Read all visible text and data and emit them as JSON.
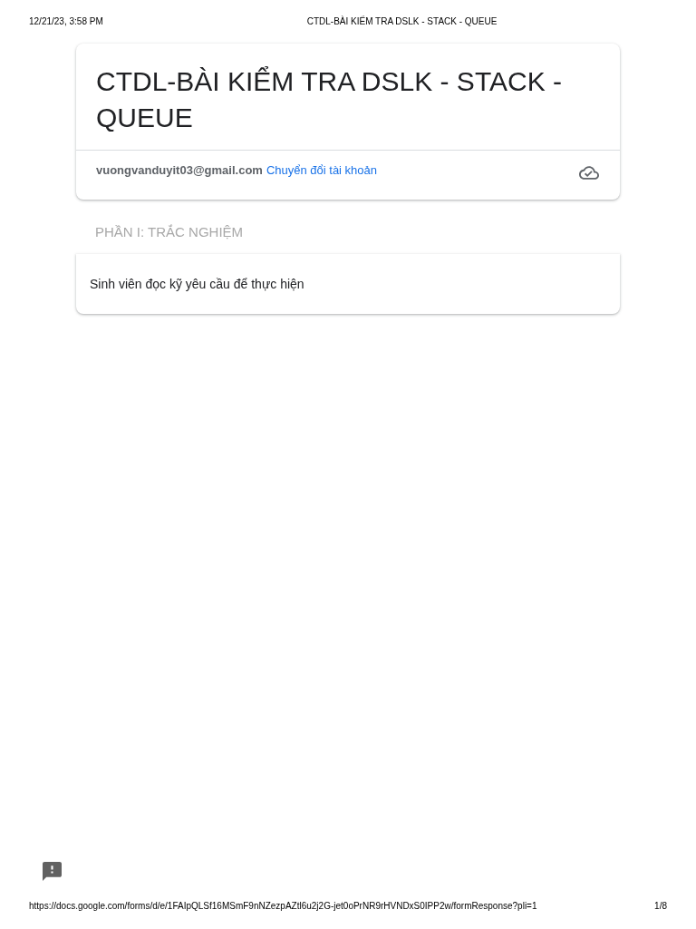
{
  "print_header": {
    "date_time": "12/21/23, 3:58 PM",
    "page_title": "CTDL-BÀI KIỂM TRA DSLK - STACK - QUEUE"
  },
  "form_header": {
    "title": "CTDL-BÀI KIỂM TRA DSLK - STACK - QUEUE",
    "account_email": "vuongvanduyit03@gmail.com",
    "switch_account_link": "Chuyển đổi tài khoản"
  },
  "section": {
    "title": "PHẦN I: TRẮC NGHIỆM",
    "description": "Sinh viên đọc kỹ yêu cầu để thực hiện"
  },
  "print_footer": {
    "url": "https://docs.google.com/forms/d/e/1FAIpQLSf16MSmF9nNZezpAZtl6u2j2G-jet0oPrNR9rHVNDxS0IPP2w/formResponse?pli=1",
    "page_number": "1/8"
  }
}
